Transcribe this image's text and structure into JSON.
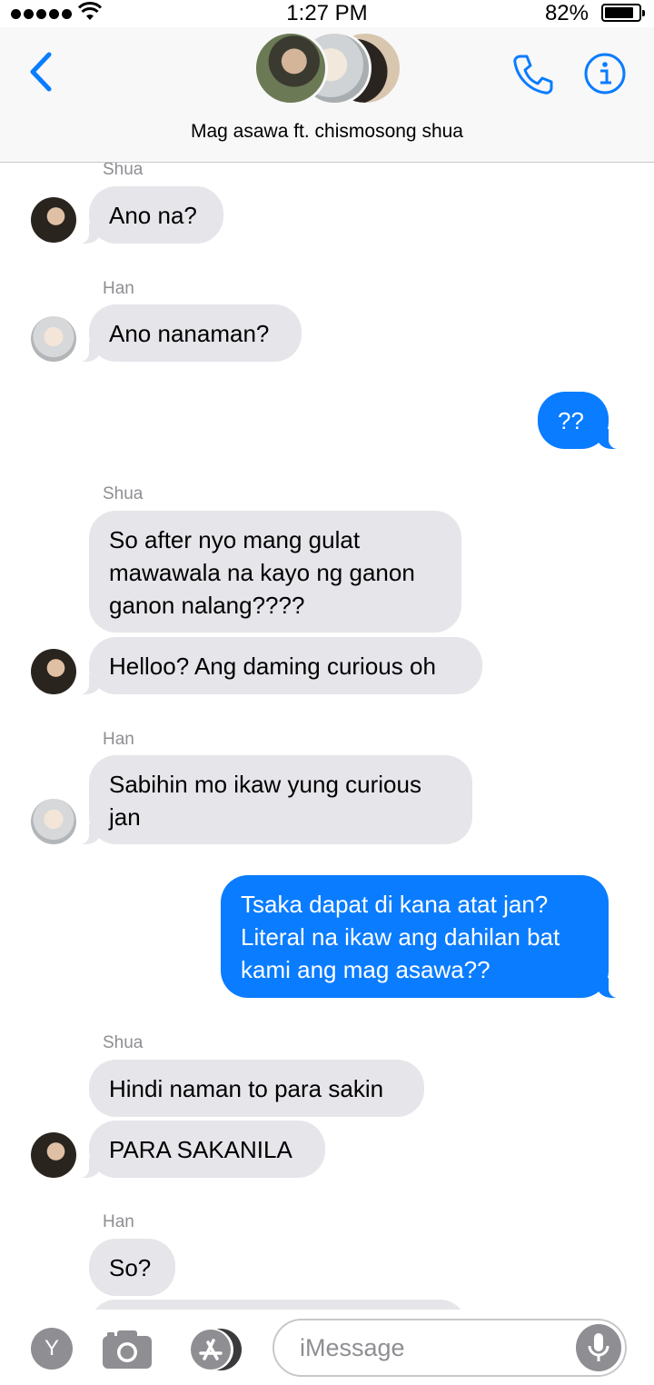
{
  "status_bar": {
    "time": "1:27 PM",
    "battery": "82%",
    "signal_icon": "signal-dots-icon",
    "wifi_icon": "wifi-icon",
    "battery_icon": "battery-icon"
  },
  "header": {
    "title": "Mag asawa ft. chismosong shua",
    "back_icon": "chevron-left-icon",
    "call_icon": "phone-icon",
    "info_icon": "info-icon",
    "accent_color": "#0a7cff"
  },
  "messages": [
    {
      "sender": "Shua",
      "text": "Ano na?"
    },
    {
      "sender": "Han",
      "text": "Ano nanaman?"
    },
    {
      "sender": "me",
      "text": "??"
    },
    {
      "sender": "Shua",
      "text": "So after nyo mang gulat mawawala na kayo ng ganon ganon nalang????"
    },
    {
      "sender": "Shua",
      "text": "Helloo? Ang daming curious oh"
    },
    {
      "sender": "Han",
      "text": "Sabihin mo ikaw yung curious jan"
    },
    {
      "sender": "me",
      "text": "Tsaka dapat di kana atat jan? Literal na ikaw ang dahilan bat kami ang mag asawa??"
    },
    {
      "sender": "Shua",
      "text": "Hindi naman to para sakin"
    },
    {
      "sender": "Shua",
      "text": "PARA SAKANILA"
    },
    {
      "sender": "Han",
      "text": "So?"
    }
  ],
  "composer": {
    "apps_button": "Y",
    "placeholder": "iMessage",
    "camera_icon": "camera-icon",
    "appstore_icon": "appstore-icon",
    "mic_icon": "microphone-icon"
  },
  "colors": {
    "incoming_bubble": "#e5e5ea",
    "outgoing_bubble": "#0a7cff",
    "sender_label": "#8e8e93"
  }
}
